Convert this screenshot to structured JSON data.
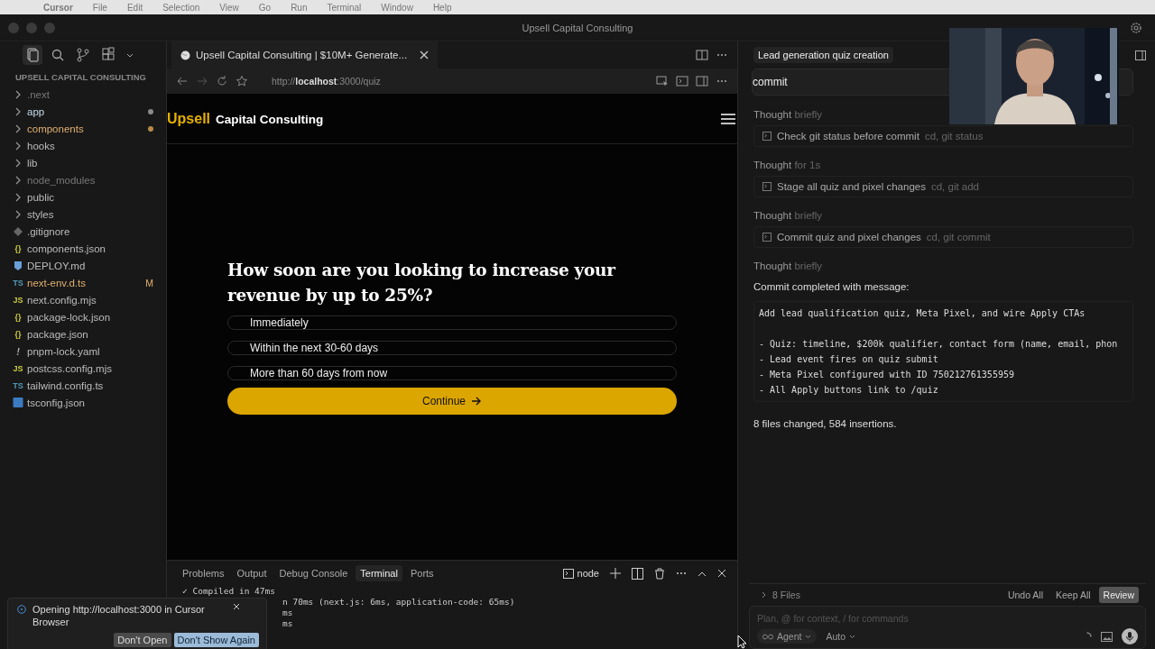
{
  "menu_bar": {
    "items": [
      "Cursor",
      "File",
      "Edit",
      "Selection",
      "View",
      "Go",
      "Run",
      "Terminal",
      "Window",
      "Help"
    ]
  },
  "window": {
    "title": "Upsell Capital Consulting"
  },
  "sidebar": {
    "header": "UPSELL CAPITAL CONSULTING",
    "items": [
      {
        "name": ".next",
        "kind": "folder",
        "ignored": true,
        "modified": false,
        "contains_changes": false
      },
      {
        "name": "app",
        "kind": "folder",
        "ignored": false,
        "modified": false,
        "contains_changes": true
      },
      {
        "name": "components",
        "kind": "folder",
        "ignored": false,
        "modified": true,
        "contains_changes": true
      },
      {
        "name": "hooks",
        "kind": "folder",
        "ignored": false,
        "modified": false,
        "contains_changes": false
      },
      {
        "name": "lib",
        "kind": "folder",
        "ignored": false,
        "modified": false,
        "contains_changes": false
      },
      {
        "name": "node_modules",
        "kind": "folder",
        "ignored": true,
        "modified": false,
        "contains_changes": false
      },
      {
        "name": "public",
        "kind": "folder",
        "ignored": false,
        "modified": false,
        "contains_changes": false
      },
      {
        "name": "styles",
        "kind": "folder",
        "ignored": false,
        "modified": false,
        "contains_changes": false
      },
      {
        "name": ".gitignore",
        "kind": "git",
        "ignored": false,
        "modified": false,
        "contains_changes": false
      },
      {
        "name": "components.json",
        "kind": "json",
        "icon_label": "{}",
        "ignored": false,
        "modified": false,
        "contains_changes": false
      },
      {
        "name": "DEPLOY.md",
        "kind": "md",
        "ignored": false,
        "modified": false,
        "contains_changes": false
      },
      {
        "name": "next-env.d.ts",
        "kind": "ts",
        "icon_label": "TS",
        "ignored": false,
        "modified": true,
        "contains_changes": false,
        "badge": "M"
      },
      {
        "name": "next.config.mjs",
        "kind": "js",
        "icon_label": "JS",
        "ignored": false,
        "modified": false,
        "contains_changes": false
      },
      {
        "name": "package-lock.json",
        "kind": "json",
        "icon_label": "{}",
        "ignored": false,
        "modified": false,
        "contains_changes": false
      },
      {
        "name": "package.json",
        "kind": "json",
        "icon_label": "{}",
        "ignored": false,
        "modified": false,
        "contains_changes": false
      },
      {
        "name": "pnpm-lock.yaml",
        "kind": "yaml",
        "icon_label": "!",
        "ignored": false,
        "modified": false,
        "contains_changes": false
      },
      {
        "name": "postcss.config.mjs",
        "kind": "js",
        "icon_label": "JS",
        "ignored": false,
        "modified": false,
        "contains_changes": false
      },
      {
        "name": "tailwind.config.ts",
        "kind": "ts",
        "icon_label": "TS",
        "ignored": false,
        "modified": false,
        "contains_changes": false
      },
      {
        "name": "tsconfig.json",
        "kind": "tsconfig",
        "ignored": false,
        "modified": false,
        "contains_changes": false
      }
    ]
  },
  "browser": {
    "tab_title": "Upsell Capital Consulting | $10M+ Generate...",
    "url": "http://**localhost**:3000/quiz",
    "page": {
      "brand_accent": "Upsell",
      "brand_rest": "Capital Consulting",
      "question": "How soon are you looking to increase your revenue by up to 25%?",
      "options": [
        {
          "label": "Immediately",
          "selected": false
        },
        {
          "label": "Within the next 30-60 days",
          "selected": false
        },
        {
          "label": "More than 60 days from now",
          "selected": false
        }
      ],
      "continue_button": "Continue"
    }
  },
  "panel": {
    "tabs": [
      {
        "label": "Problems",
        "selected": false
      },
      {
        "label": "Output",
        "selected": false
      },
      {
        "label": "Debug Console",
        "selected": false
      },
      {
        "label": "Terminal",
        "selected": true
      },
      {
        "label": "Ports",
        "selected": false
      }
    ],
    "terminal_name": "node",
    "lines": [
      "✓ Compiled in 47ms"
    ],
    "lines_partly_covered": [
      "n 70ms (next.js: 6ms, application-code: 65ms)",
      "ms",
      "ms"
    ]
  },
  "toast": {
    "message": "Opening http://localhost:3000 in Cursor Browser",
    "buttons": [
      {
        "label": "Don't Open",
        "kind": "secondary"
      },
      {
        "label": "Don't Show Again",
        "kind": "primary"
      }
    ]
  },
  "chat": {
    "title": "Lead generation quiz creation",
    "prompt": "commit",
    "entries": [
      {
        "kind": "thought",
        "label": "Thought",
        "detail": "briefly"
      },
      {
        "kind": "tool",
        "title": "Check git status before commit",
        "detail": "cd, git status"
      },
      {
        "kind": "thought",
        "label": "Thought",
        "detail": "for 1s"
      },
      {
        "kind": "tool",
        "title": "Stage all quiz and pixel changes",
        "detail": "cd, git add"
      },
      {
        "kind": "thought",
        "label": "Thought",
        "detail": "briefly"
      },
      {
        "kind": "tool",
        "title": "Commit quiz and pixel changes",
        "detail": "cd, git commit"
      },
      {
        "kind": "thought",
        "label": "Thought",
        "detail": "briefly"
      },
      {
        "kind": "text",
        "text": "Commit completed with message:"
      },
      {
        "kind": "code",
        "paragraphs": [
          [
            "Add lead qualification quiz, Meta Pixel, and wire Apply CTAs"
          ],
          [
            "- Quiz: timeline, $200k qualifier, contact form (name, email, phon",
            "- Lead event fires on quiz submit",
            "- Meta Pixel configured with ID 750212761355959",
            "- All Apply buttons link to /quiz"
          ]
        ]
      },
      {
        "kind": "text",
        "text": "8 files changed, 584 insertions."
      }
    ],
    "files_button": "8 Files",
    "actions": [
      {
        "label": "Undo All",
        "selected": false
      },
      {
        "label": "Keep All",
        "selected": false
      },
      {
        "label": "Review",
        "selected": true
      }
    ],
    "input_placeholder": "Plan, @ for context, / for commands",
    "mode": "Agent",
    "model": "Auto"
  }
}
